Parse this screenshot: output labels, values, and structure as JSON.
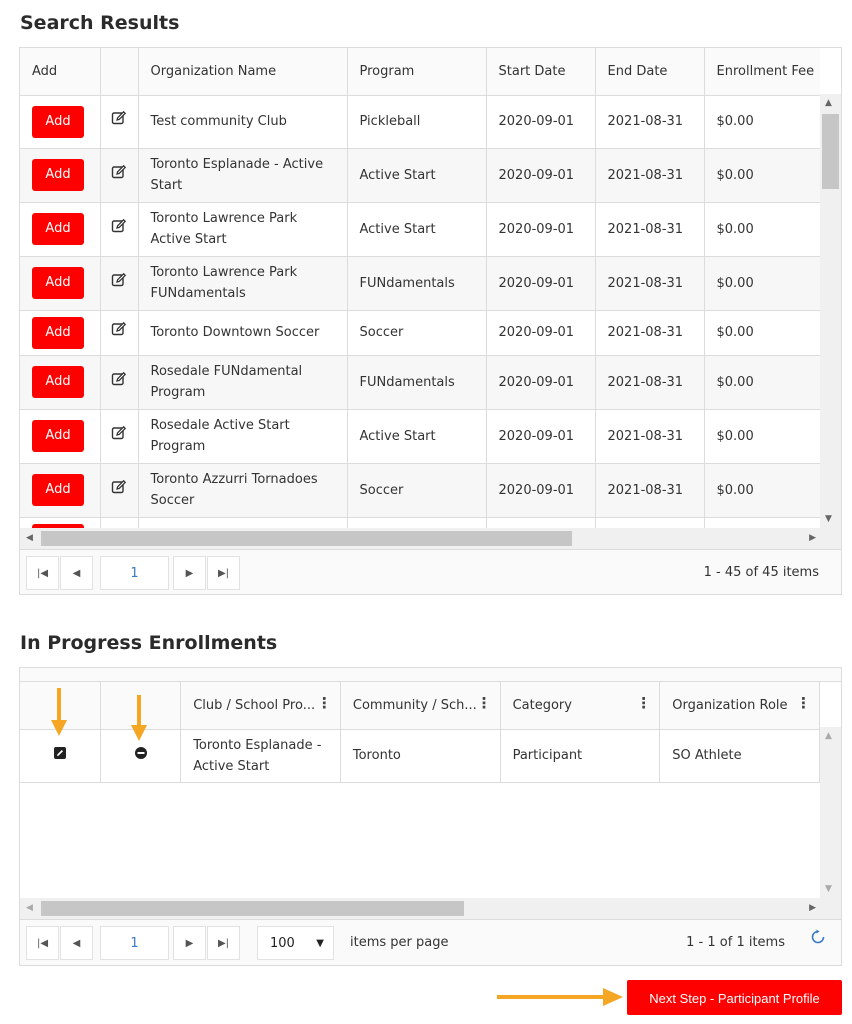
{
  "search_results": {
    "title": "Search Results",
    "columns": [
      "Add",
      "",
      "Organization Name",
      "Program",
      "Start Date",
      "End Date",
      "Enrollment Fee"
    ],
    "rows": [
      {
        "add": "Add",
        "org": "Test community Club",
        "program": "Pickleball",
        "start": "2020-09-01",
        "end": "2021-08-31",
        "fee": "$0.00"
      },
      {
        "add": "Add",
        "org": "Toronto Esplanade - Active Start",
        "program": "Active Start",
        "start": "2020-09-01",
        "end": "2021-08-31",
        "fee": "$0.00"
      },
      {
        "add": "Add",
        "org": "Toronto Lawrence Park Active Start",
        "program": "Active Start",
        "start": "2020-09-01",
        "end": "2021-08-31",
        "fee": "$0.00"
      },
      {
        "add": "Add",
        "org": "Toronto Lawrence Park FUNdamentals",
        "program": "FUNdamentals",
        "start": "2020-09-01",
        "end": "2021-08-31",
        "fee": "$0.00"
      },
      {
        "add": "Add",
        "org": "Toronto Downtown Soccer",
        "program": "Soccer",
        "start": "2020-09-01",
        "end": "2021-08-31",
        "fee": "$0.00"
      },
      {
        "add": "Add",
        "org": "Rosedale FUNdamental Program",
        "program": "FUNdamentals",
        "start": "2020-09-01",
        "end": "2021-08-31",
        "fee": "$0.00"
      },
      {
        "add": "Add",
        "org": "Rosedale Active Start Program",
        "program": "Active Start",
        "start": "2020-09-01",
        "end": "2021-08-31",
        "fee": "$0.00"
      },
      {
        "add": "Add",
        "org": "Toronto Azzurri Tornadoes Soccer",
        "program": "Soccer",
        "start": "2020-09-01",
        "end": "2021-08-31",
        "fee": "$0.00"
      }
    ],
    "pager": {
      "page": "1",
      "info": "1 - 45 of 45 items"
    }
  },
  "in_progress": {
    "title": "In Progress Enrollments",
    "columns": [
      "",
      "",
      "Club / School Pro...",
      "Community / Sch...",
      "Category",
      "Organization Role"
    ],
    "rows": [
      {
        "club": "Toronto Esplanade - Active Start",
        "community": "Toronto",
        "category": "Participant",
        "role": "SO Athlete"
      }
    ],
    "pager": {
      "page": "1",
      "page_size": "100",
      "items_per_page_label": "items per page",
      "info": "1 - 1 of 1 items"
    }
  },
  "next_step_label": "Next Step - Participant Profile",
  "colors": {
    "accent_red": "#ff0000",
    "arrow_gold": "#f5a623",
    "link_blue": "#3b79c4"
  },
  "icons": [
    "edit-icon",
    "remove-icon",
    "first-page-icon",
    "prev-page-icon",
    "next-page-icon",
    "last-page-icon",
    "refresh-icon",
    "dropdown-caret-icon",
    "column-menu-icon"
  ]
}
